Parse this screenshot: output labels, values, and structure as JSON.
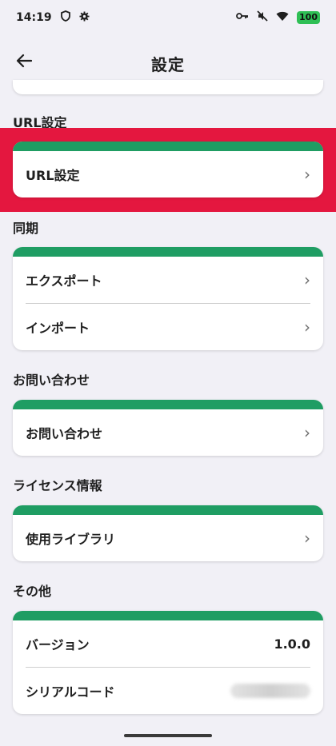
{
  "status": {
    "time": "14:19",
    "battery": "100"
  },
  "header": {
    "title": "設定"
  },
  "sections": {
    "url": {
      "label": "URL設定",
      "item": "URL設定"
    },
    "sync": {
      "label": "同期",
      "export": "エクスポート",
      "import": "インポート"
    },
    "contact": {
      "label": "お問い合わせ",
      "item": "お問い合わせ"
    },
    "license": {
      "label": "ライセンス情報",
      "item": "使用ライブラリ"
    },
    "other": {
      "label": "その他",
      "version_label": "バージョン",
      "version_value": "1.0.0",
      "serial_label": "シリアルコード"
    }
  },
  "chevron": "›",
  "colors": {
    "accent": "#1f9d63",
    "highlight": "#e4173f",
    "background": "#f1f0f6"
  },
  "icons": [
    "back-arrow-icon",
    "chevron-right-icon",
    "wifi-icon",
    "key-icon",
    "mute-icon",
    "gear-icon",
    "shield-icon"
  ]
}
